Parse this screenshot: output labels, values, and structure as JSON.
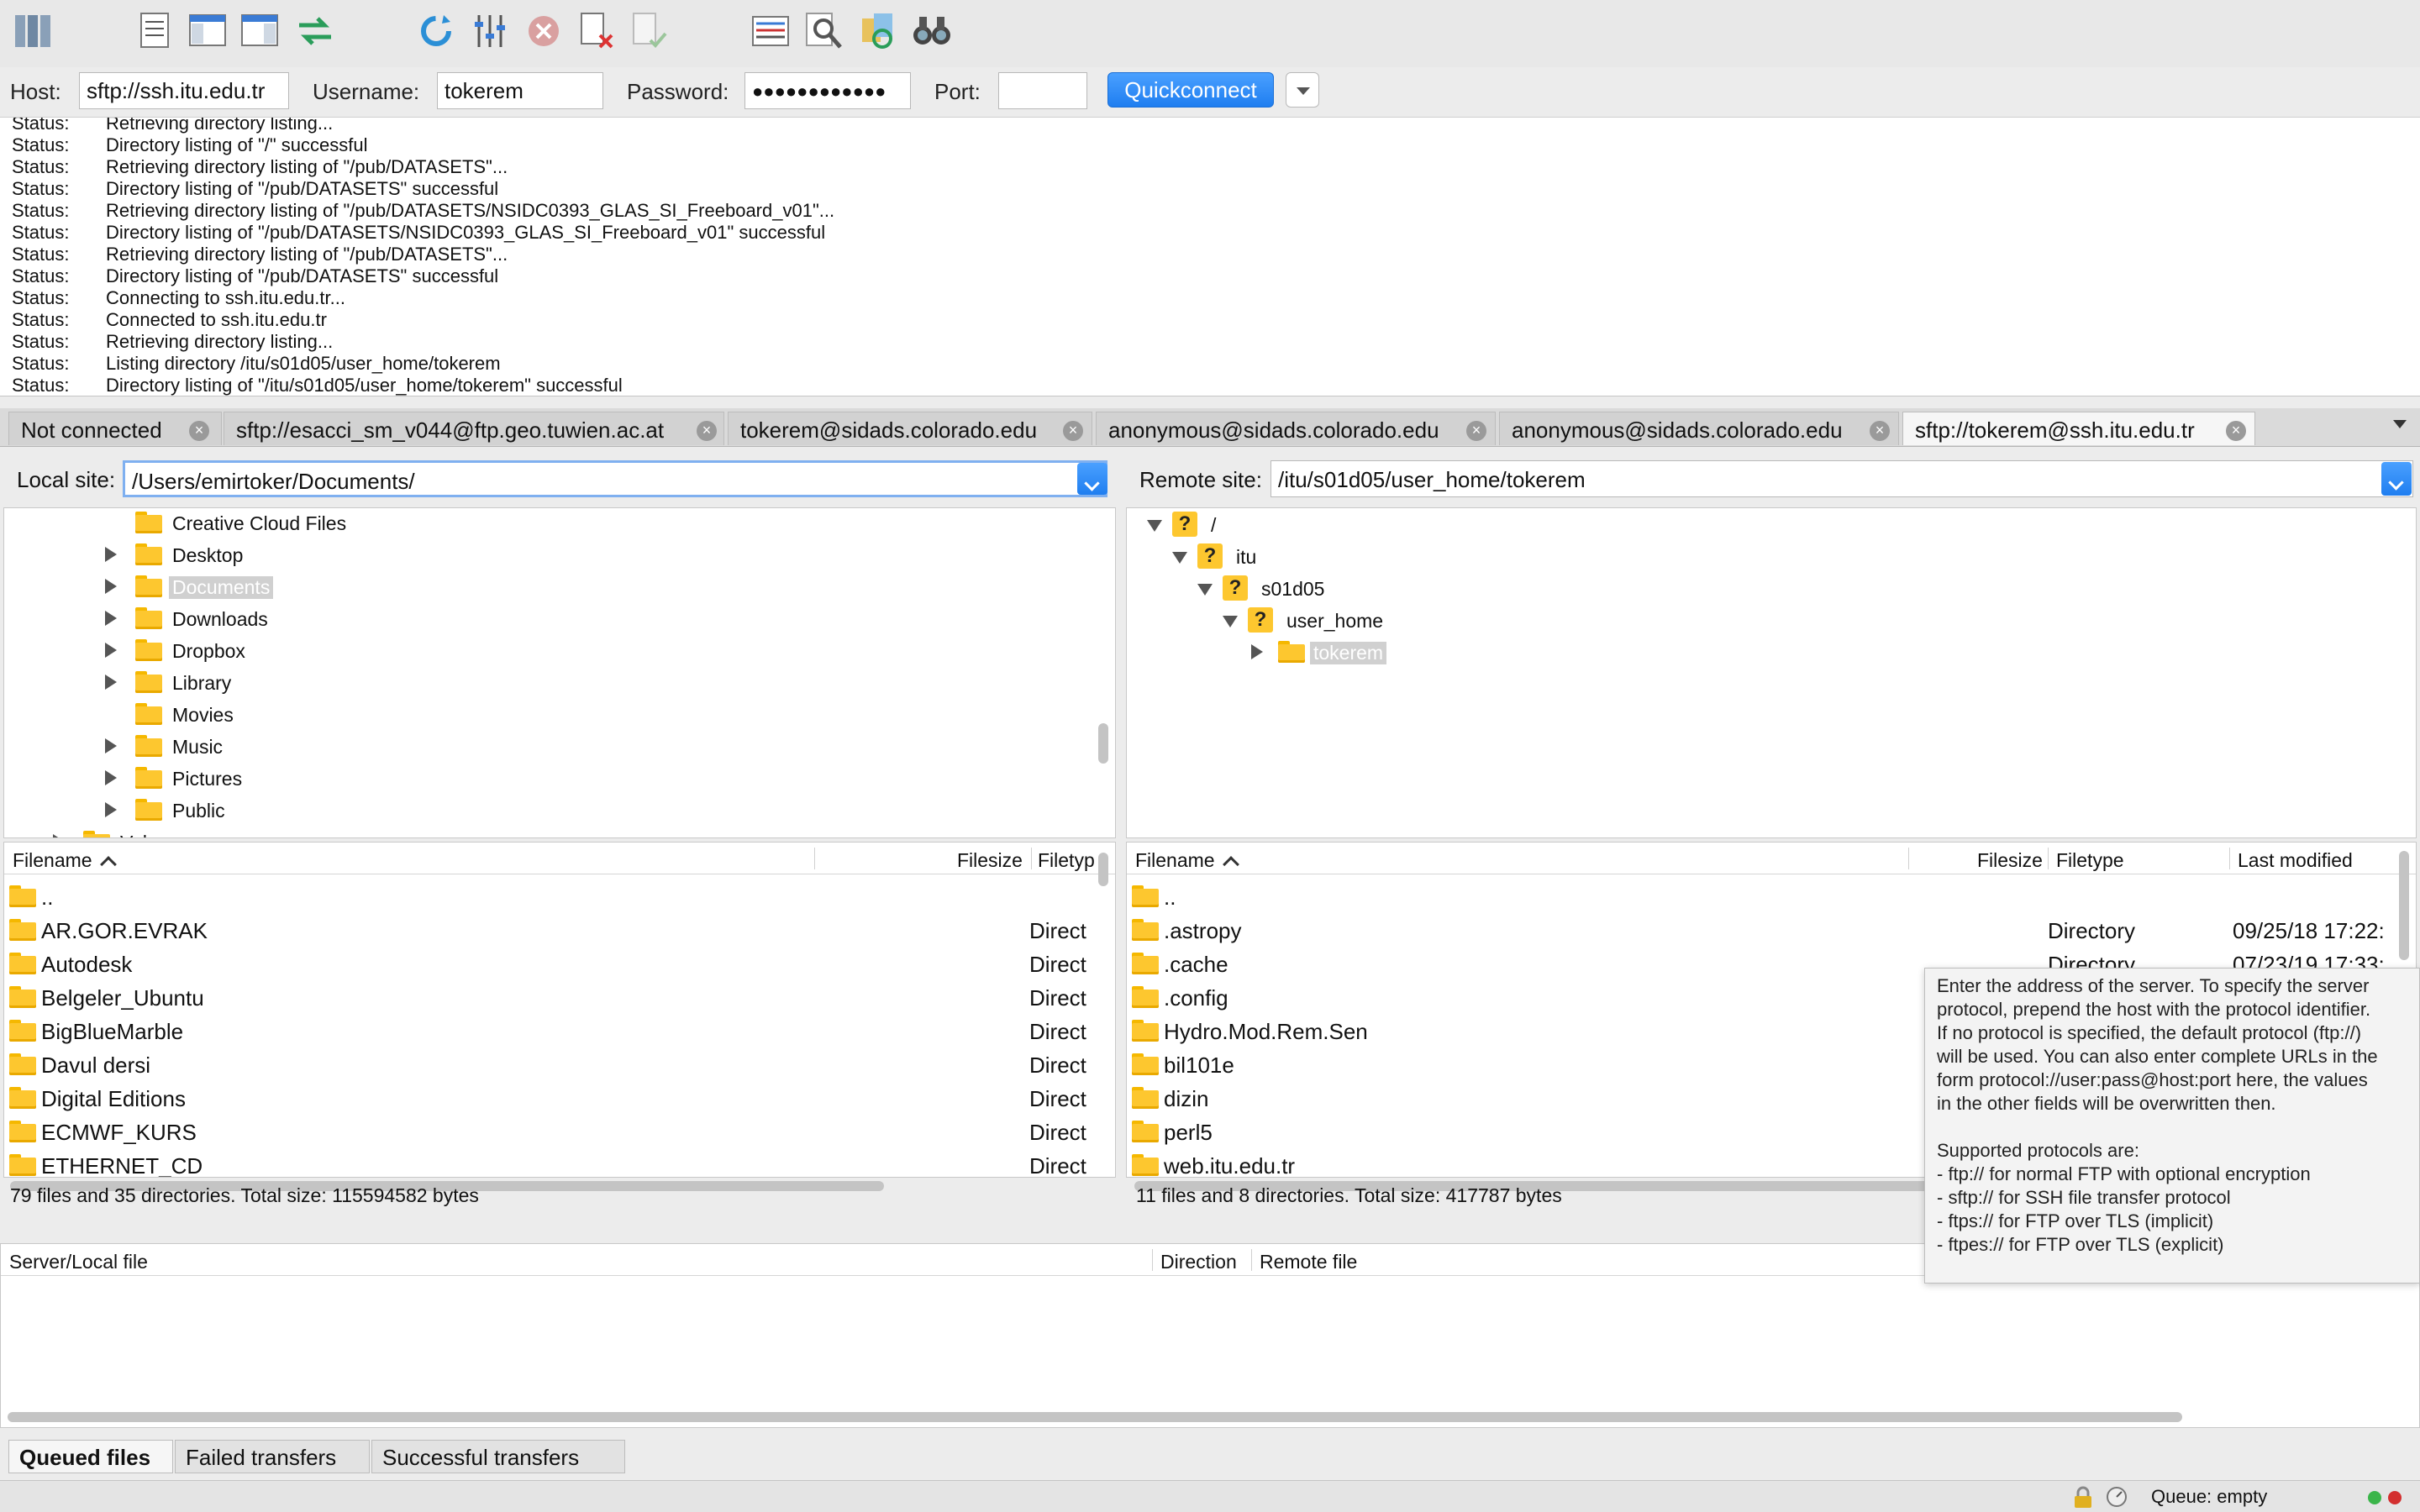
{
  "quickconnect": {
    "host_label": "Host:",
    "host_value": "sftp://ssh.itu.edu.tr",
    "username_label": "Username:",
    "username_value": "tokerem",
    "password_label": "Password:",
    "password_value": "●●●●●●●●●●●●",
    "port_label": "Port:",
    "port_value": "",
    "button_label": "Quickconnect"
  },
  "log": [
    {
      "key": "Status:",
      "text": "Retrieving directory listing..."
    },
    {
      "key": "Status:",
      "text": "Directory listing of \"/\" successful"
    },
    {
      "key": "Status:",
      "text": "Retrieving directory listing of \"/pub/DATASETS\"..."
    },
    {
      "key": "Status:",
      "text": "Directory listing of \"/pub/DATASETS\" successful"
    },
    {
      "key": "Status:",
      "text": "Retrieving directory listing of \"/pub/DATASETS/NSIDC0393_GLAS_SI_Freeboard_v01\"..."
    },
    {
      "key": "Status:",
      "text": "Directory listing of \"/pub/DATASETS/NSIDC0393_GLAS_SI_Freeboard_v01\" successful"
    },
    {
      "key": "Status:",
      "text": "Retrieving directory listing of \"/pub/DATASETS\"..."
    },
    {
      "key": "Status:",
      "text": "Directory listing of \"/pub/DATASETS\" successful"
    },
    {
      "key": "Status:",
      "text": "Connecting to ssh.itu.edu.tr..."
    },
    {
      "key": "Status:",
      "text": "Connected to ssh.itu.edu.tr"
    },
    {
      "key": "Status:",
      "text": "Retrieving directory listing..."
    },
    {
      "key": "Status:",
      "text": "Listing directory /itu/s01d05/user_home/tokerem"
    },
    {
      "key": "Status:",
      "text": "Directory listing of \"/itu/s01d05/user_home/tokerem\" successful"
    }
  ],
  "tabs": [
    {
      "label": "Not connected"
    },
    {
      "label": "sftp://esacci_sm_v044@ftp.geo.tuwien.ac.at"
    },
    {
      "label": "tokerem@sidads.colorado.edu"
    },
    {
      "label": "anonymous@sidads.colorado.edu"
    },
    {
      "label": "anonymous@sidads.colorado.edu"
    },
    {
      "label": "sftp://tokerem@ssh.itu.edu.tr"
    }
  ],
  "local": {
    "site_label": "Local site:",
    "site_path": "/Users/emirtoker/Documents/",
    "tree": [
      {
        "label": "Creative Cloud Files"
      },
      {
        "label": "Desktop"
      },
      {
        "label": "Documents"
      },
      {
        "label": "Downloads"
      },
      {
        "label": "Dropbox"
      },
      {
        "label": "Library"
      },
      {
        "label": "Movies"
      },
      {
        "label": "Music"
      },
      {
        "label": "Pictures"
      },
      {
        "label": "Public"
      },
      {
        "label": "Vol..."
      }
    ],
    "headers": {
      "filename": "Filename",
      "filesize": "Filesize",
      "filetype": "Filetyp"
    },
    "files": [
      {
        "name": "..",
        "type": ""
      },
      {
        "name": "AR.GOR.EVRAK",
        "type": "Direct"
      },
      {
        "name": "Autodesk",
        "type": "Direct"
      },
      {
        "name": "Belgeler_Ubuntu",
        "type": "Direct"
      },
      {
        "name": "BigBlueMarble",
        "type": "Direct"
      },
      {
        "name": "Davul dersi",
        "type": "Direct"
      },
      {
        "name": "Digital Editions",
        "type": "Direct"
      },
      {
        "name": "ECMWF_KURS",
        "type": "Direct"
      },
      {
        "name": "ETHERNET_CD",
        "type": "Direct"
      }
    ],
    "status": "79 files and 35 directories. Total size: 115594582 bytes"
  },
  "remote": {
    "site_label": "Remote site:",
    "site_path": "/itu/s01d05/user_home/tokerem",
    "tree": [
      {
        "label": "/"
      },
      {
        "label": "itu"
      },
      {
        "label": "s01d05"
      },
      {
        "label": "user_home"
      },
      {
        "label": "tokerem"
      }
    ],
    "headers": {
      "filename": "Filename",
      "filesize": "Filesize",
      "filetype": "Filetype",
      "modified": "Last modified"
    },
    "files": [
      {
        "name": "..",
        "type": "",
        "date": ""
      },
      {
        "name": ".astropy",
        "type": "Directory",
        "date": "09/25/18 17:22:"
      },
      {
        "name": ".cache",
        "type": "Directory",
        "date": "07/23/19 17:33:"
      },
      {
        "name": ".config",
        "type": "",
        "date": ""
      },
      {
        "name": "Hydro.Mod.Rem.Sen",
        "type": "",
        "date": ""
      },
      {
        "name": "bil101e",
        "type": "",
        "date": ""
      },
      {
        "name": "dizin",
        "type": "",
        "date": ""
      },
      {
        "name": "perl5",
        "type": "",
        "date": ""
      },
      {
        "name": "web.itu.edu.tr",
        "type": "",
        "date": ""
      }
    ],
    "status": "11 files and 8 directories. Total size: 417787 bytes"
  },
  "queue": {
    "headers": {
      "server": "Server/Local file",
      "direction": "Direction",
      "remote": "Remote file"
    }
  },
  "bottom_tabs": [
    {
      "label": "Queued files"
    },
    {
      "label": "Failed transfers"
    },
    {
      "label": "Successful transfers"
    }
  ],
  "statusbar": {
    "queue": "Queue: empty"
  },
  "tooltip": {
    "lines": [
      "Enter the address of the server. To specify the server",
      "protocol, prepend the host with the protocol identifier.",
      "If no protocol is specified, the default protocol (ftp://)",
      "will be used. You can also enter complete URLs in the",
      "form protocol://user:pass@host:port here, the values",
      "in the other fields will be overwritten then.",
      "",
      "Supported protocols are:",
      "- ftp:// for normal FTP with optional encryption",
      "- sftp:// for SSH file transfer protocol",
      "- ftps:// for FTP over TLS (implicit)",
      "- ftpes:// for FTP over TLS (explicit)"
    ]
  },
  "colors": {
    "accent": "#1f7ef0",
    "folder": "#fdc72f"
  }
}
